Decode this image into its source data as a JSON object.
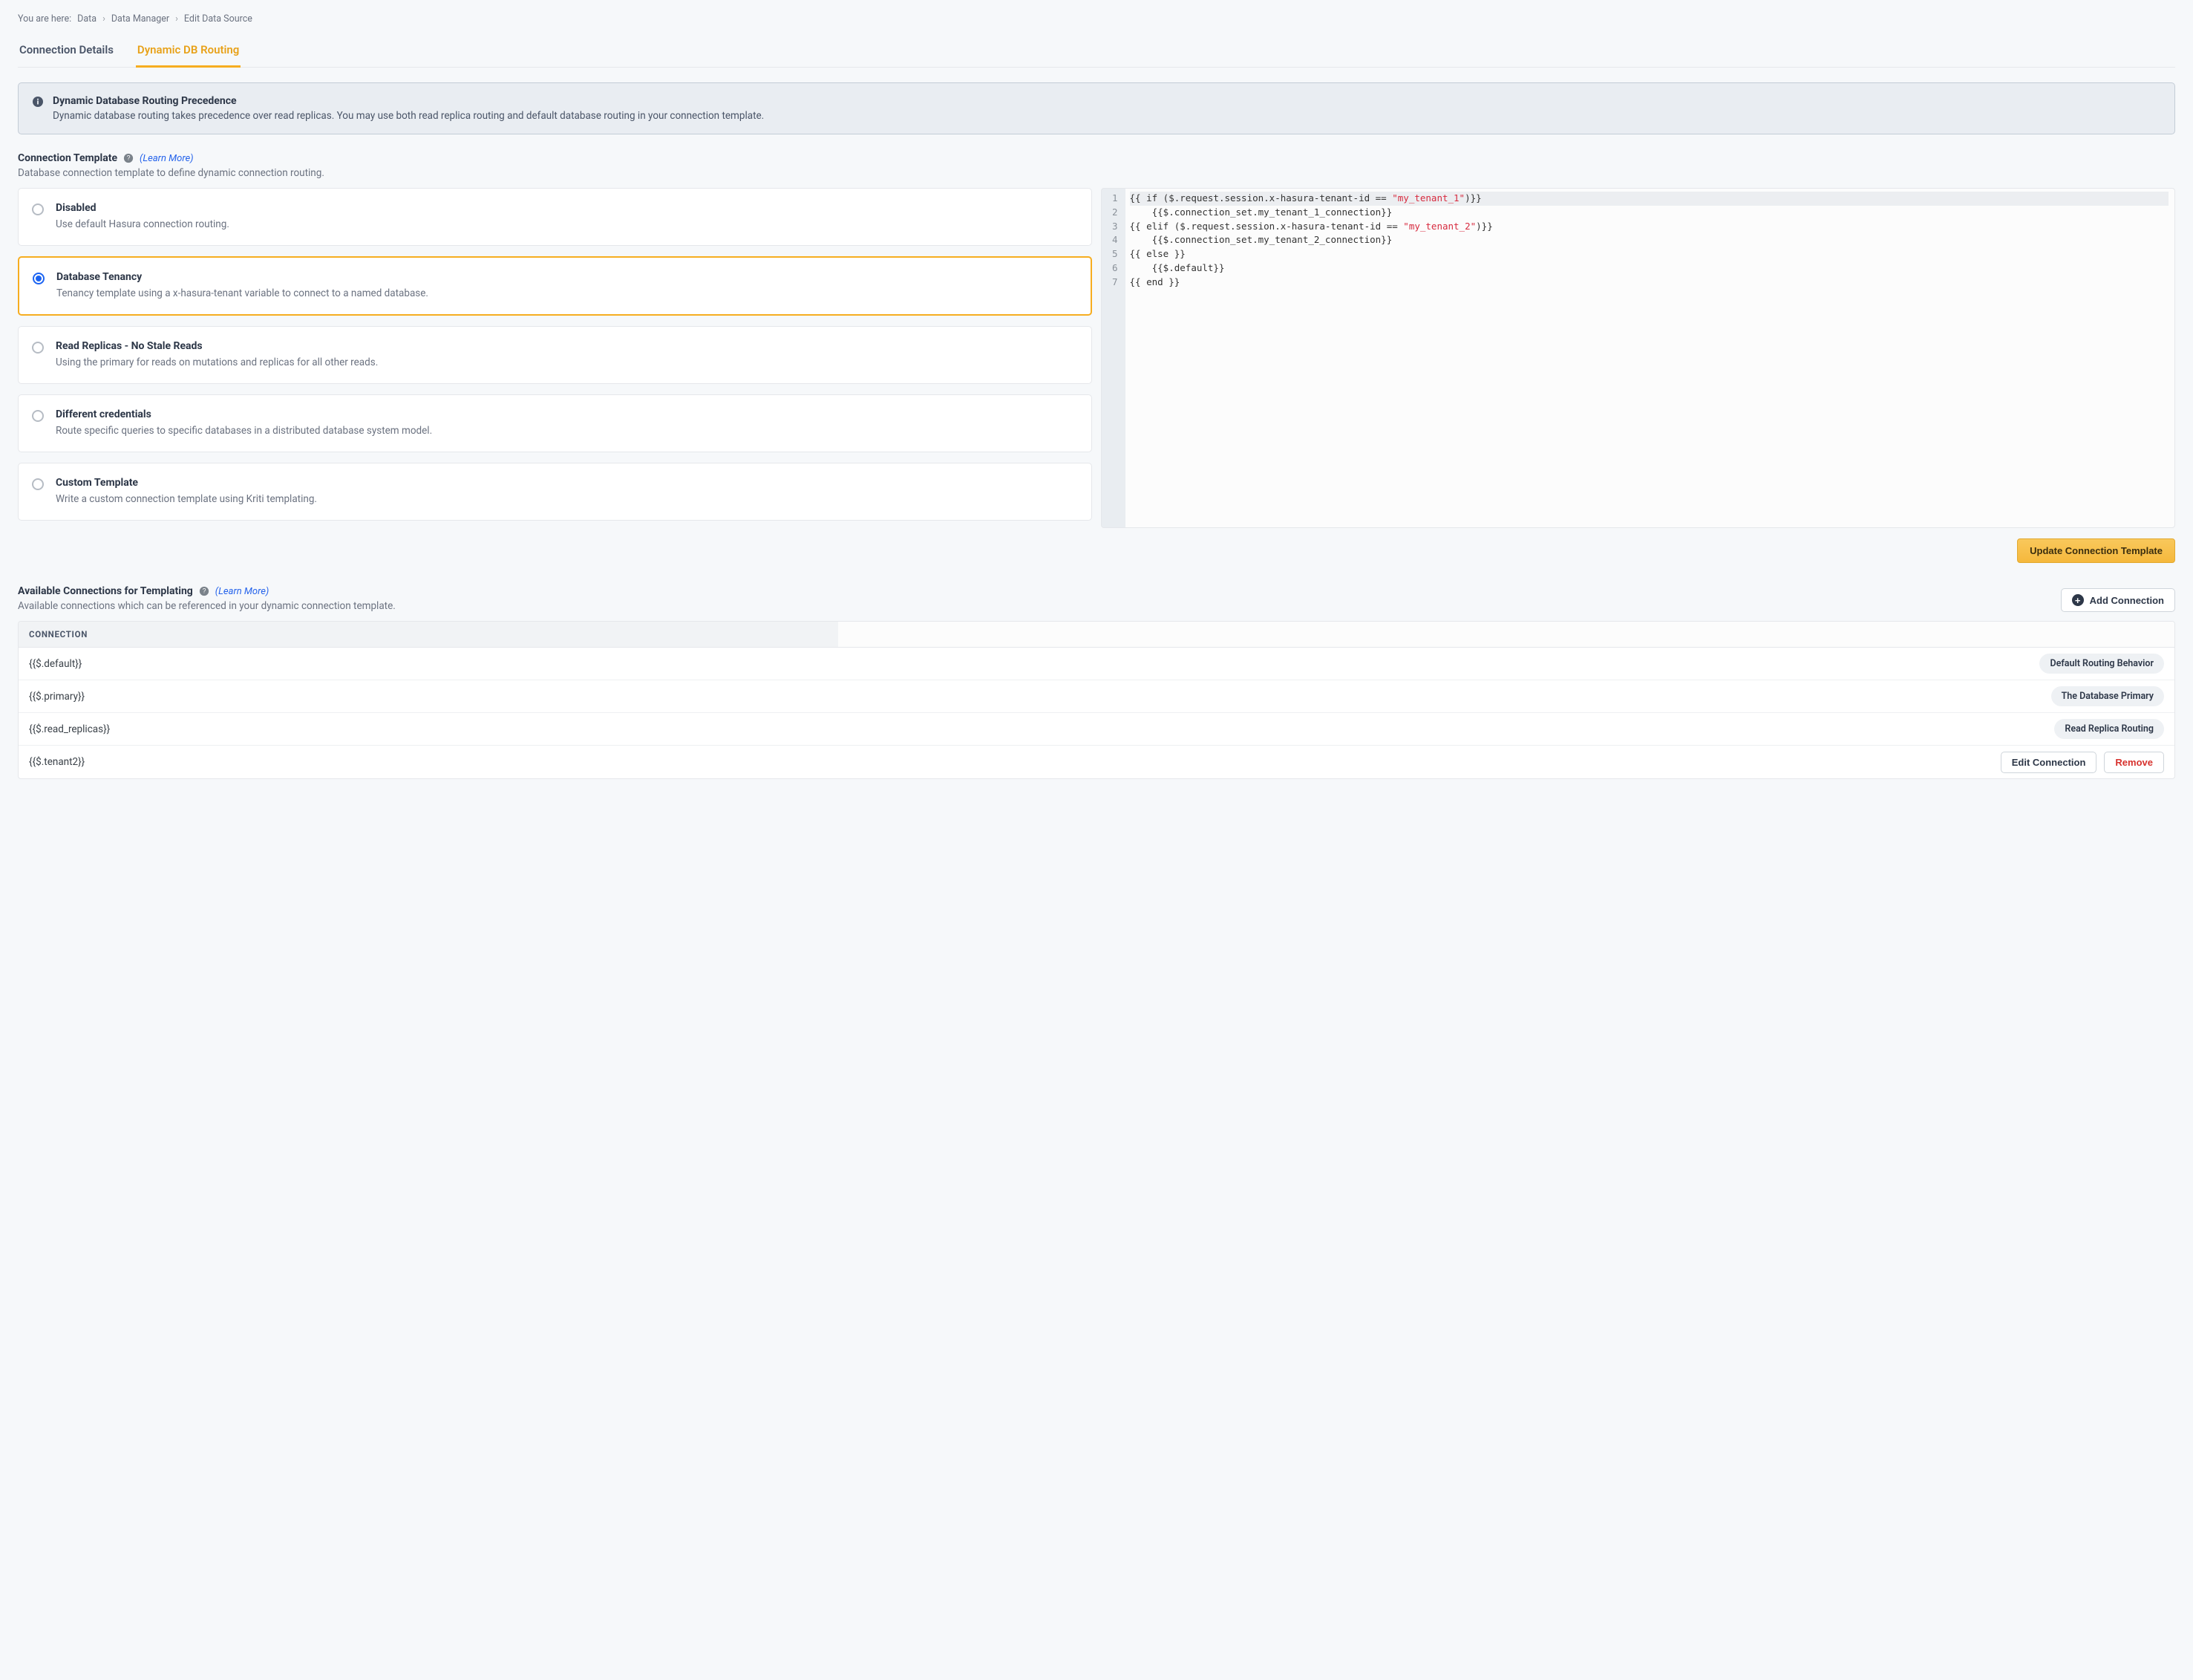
{
  "breadcrumb": {
    "prefix": "You are here:",
    "items": [
      "Data",
      "Data Manager",
      "Edit Data Source"
    ]
  },
  "tabs": [
    {
      "label": "Connection Details",
      "active": false
    },
    {
      "label": "Dynamic DB Routing",
      "active": true
    }
  ],
  "callout": {
    "title": "Dynamic Database Routing Precedence",
    "body": "Dynamic database routing takes precedence over read replicas. You may use both read replica routing and default database routing in your connection template."
  },
  "template_section": {
    "label": "Connection Template",
    "learn_more": "(Learn More)",
    "desc": "Database connection template to define dynamic connection routing.",
    "options": [
      {
        "title": "Disabled",
        "desc": "Use default Hasura connection routing.",
        "selected": false
      },
      {
        "title": "Database Tenancy",
        "desc": "Tenancy template using a x-hasura-tenant variable to connect to a named database.",
        "selected": true
      },
      {
        "title": "Read Replicas - No Stale Reads",
        "desc": "Using the primary for reads on mutations and replicas for all other reads.",
        "selected": false
      },
      {
        "title": "Different credentials",
        "desc": "Route specific queries to specific databases in a distributed database system model.",
        "selected": false
      },
      {
        "title": "Custom Template",
        "desc": "Write a custom connection template using Kriti templating.",
        "selected": false
      }
    ],
    "code": {
      "lines": [
        {
          "n": 1,
          "pre": "{{ if ($.request.session.x-hasura-tenant-id == ",
          "str": "\"my_tenant_1\"",
          "post": ")}}"
        },
        {
          "n": 2,
          "pre": "    {{$.connection_set.my_tenant_1_connection}}",
          "str": "",
          "post": ""
        },
        {
          "n": 3,
          "pre": "{{ elif ($.request.session.x-hasura-tenant-id == ",
          "str": "\"my_tenant_2\"",
          "post": ")}}"
        },
        {
          "n": 4,
          "pre": "    {{$.connection_set.my_tenant_2_connection}}",
          "str": "",
          "post": ""
        },
        {
          "n": 5,
          "pre": "{{ else }}",
          "str": "",
          "post": ""
        },
        {
          "n": 6,
          "pre": "    {{$.default}}",
          "str": "",
          "post": ""
        },
        {
          "n": 7,
          "pre": "{{ end }}",
          "str": "",
          "post": ""
        }
      ]
    },
    "update_btn": "Update Connection Template"
  },
  "connections_section": {
    "label": "Available Connections for Templating",
    "learn_more": "(Learn More)",
    "desc": "Available connections which can be referenced in your dynamic connection template.",
    "add_btn": "Add Connection",
    "column_header": "CONNECTION",
    "rows": [
      {
        "name": "{{$.default}}",
        "badge": "Default Routing Behavior",
        "editable": false
      },
      {
        "name": "{{$.primary}}",
        "badge": "The Database Primary",
        "editable": false
      },
      {
        "name": "{{$.read_replicas}}",
        "badge": "Read Replica Routing",
        "editable": false
      },
      {
        "name": "{{$.tenant2}}",
        "badge": null,
        "editable": true
      }
    ],
    "edit_btn": "Edit Connection",
    "remove_btn": "Remove"
  }
}
